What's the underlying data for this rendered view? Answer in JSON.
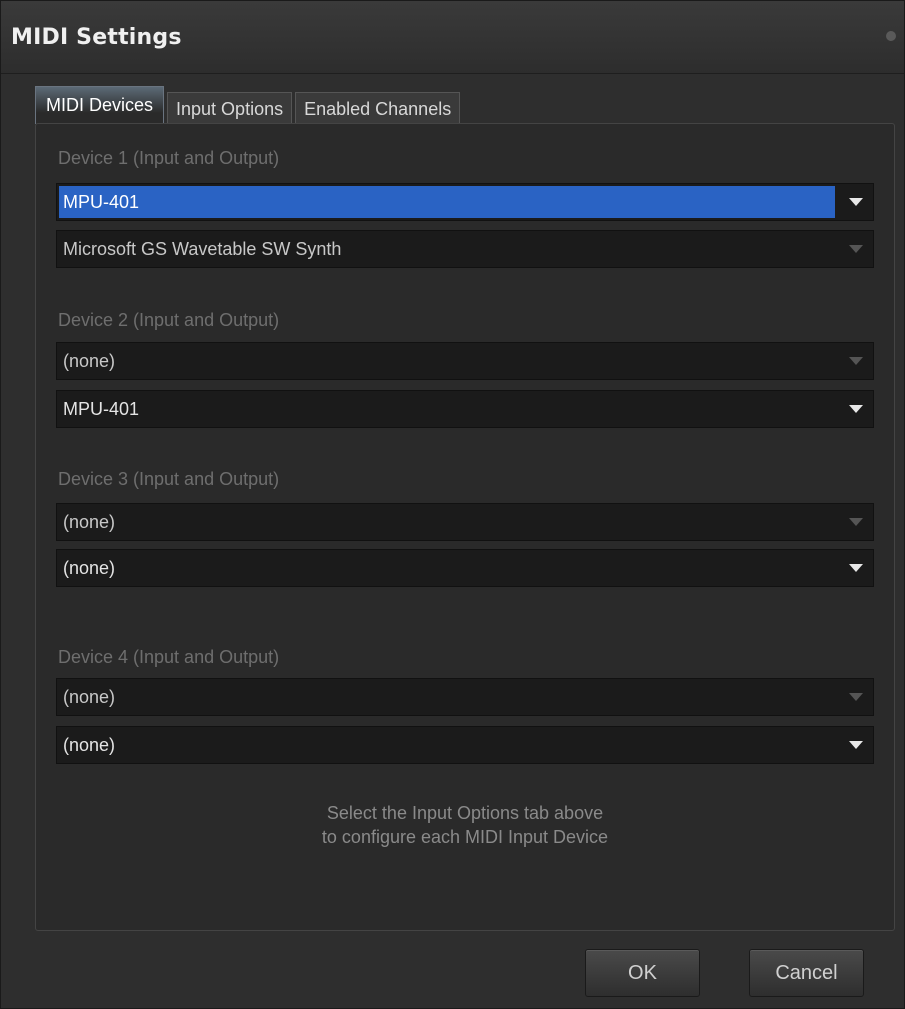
{
  "window": {
    "title": "MIDI Settings"
  },
  "tabs": [
    {
      "label": "MIDI Devices",
      "active": true
    },
    {
      "label": "Input Options",
      "active": false
    },
    {
      "label": "Enabled Channels",
      "active": false
    }
  ],
  "devices": [
    {
      "label": "Device 1 (Input and Output)",
      "input": "MPU-401",
      "output": "Microsoft GS Wavetable SW Synth"
    },
    {
      "label": "Device 2 (Input and Output)",
      "input": "(none)",
      "output": "MPU-401"
    },
    {
      "label": "Device 3 (Input and Output)",
      "input": "(none)",
      "output": "(none)"
    },
    {
      "label": "Device 4 (Input and Output)",
      "input": "(none)",
      "output": "(none)"
    }
  ],
  "hint": {
    "line1": "Select the Input Options tab above",
    "line2": "to configure each MIDI Input Device"
  },
  "buttons": {
    "ok": "OK",
    "cancel": "Cancel"
  },
  "colors": {
    "selection": "#2a63c4",
    "background": "#2e2e2e"
  },
  "icons": {
    "dropdown": "chevron-down-icon"
  }
}
